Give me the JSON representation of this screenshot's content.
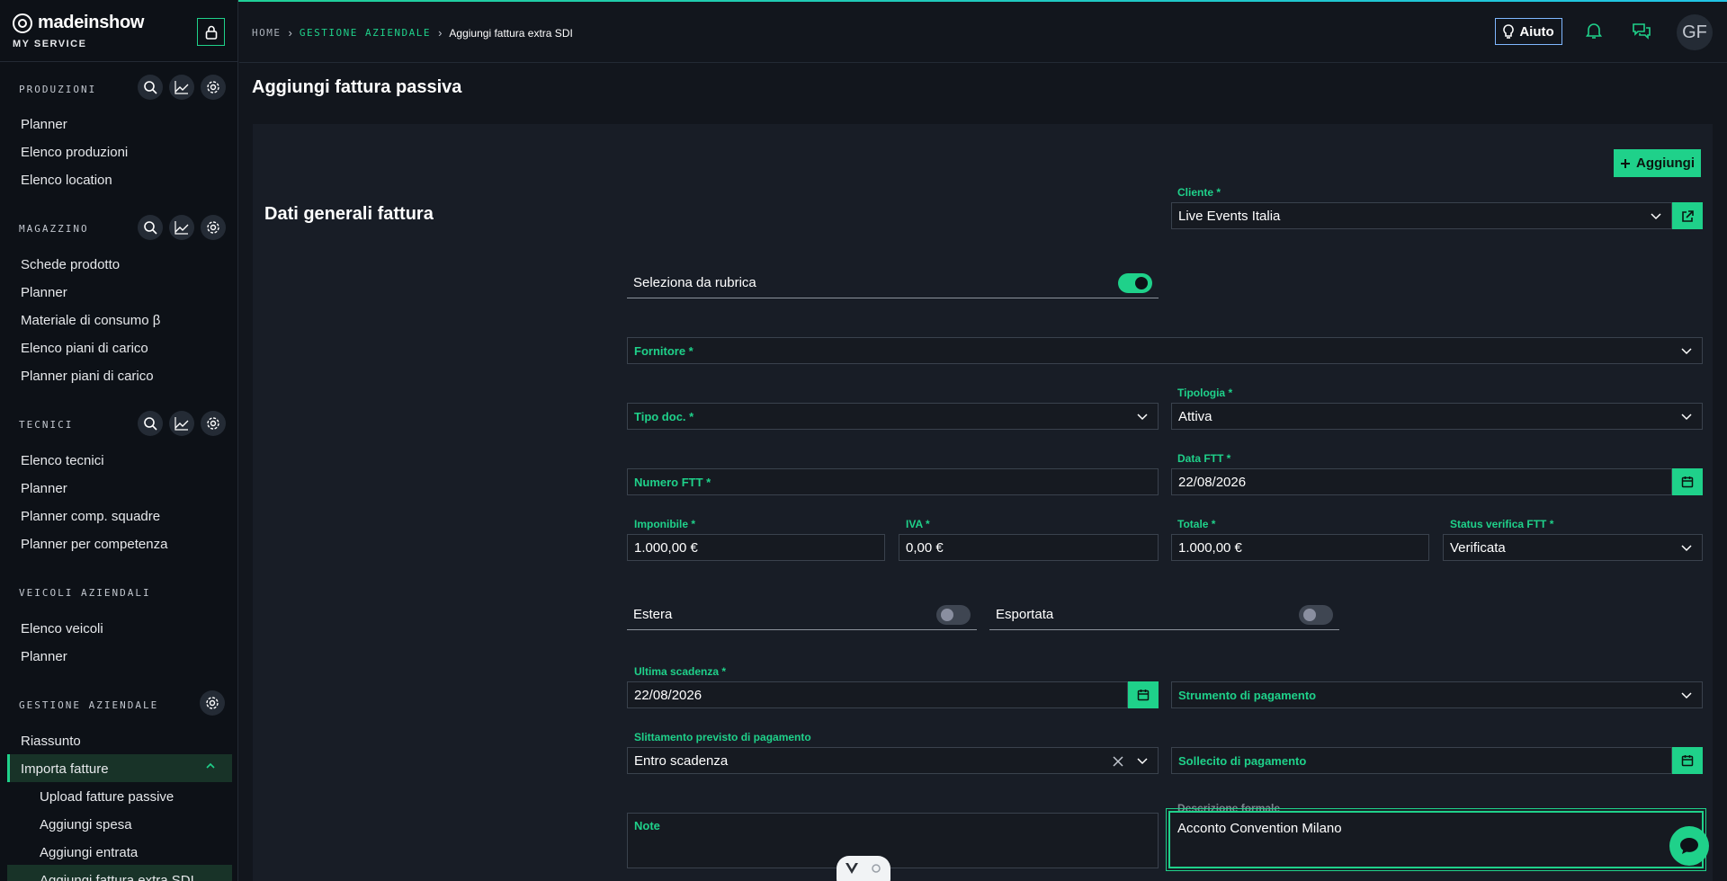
{
  "brand": {
    "name": "madeinshow",
    "subtitle": "MY SERVICE"
  },
  "sidebar": {
    "sections": [
      {
        "title": "PRODUZIONI",
        "items": [
          "Planner",
          "Elenco produzioni",
          "Elenco location"
        ]
      },
      {
        "title": "MAGAZZINO",
        "items": [
          "Schede prodotto",
          "Planner",
          "Materiale di consumo β",
          "Elenco piani di carico",
          "Planner piani di carico"
        ]
      },
      {
        "title": "TECNICI",
        "items": [
          "Elenco tecnici",
          "Planner",
          "Planner comp. squadre",
          "Planner per competenza"
        ]
      },
      {
        "title": "VEICOLI AZIENDALI",
        "items": [
          "Elenco veicoli",
          "Planner"
        ]
      },
      {
        "title": "GESTIONE AZIENDALE",
        "items": [
          "Riassunto",
          "Importa fatture"
        ]
      }
    ],
    "sub_items": [
      "Upload fatture passive",
      "Aggiungi spesa",
      "Aggiungi entrata",
      "Aggiungi fattura extra SDI"
    ]
  },
  "header": {
    "breadcrumb_home": "HOME",
    "breadcrumb_section": "GESTIONE AZIENDALE",
    "breadcrumb_current": "Aggiungi fattura extra SDI",
    "help_label": "Aiuto",
    "avatar_initials": "GF"
  },
  "page": {
    "title": "Aggiungi fattura passiva",
    "add_button": "Aggiungi",
    "section_title": "Dati generali fattura"
  },
  "form": {
    "cliente_label": "Cliente *",
    "cliente_value": "Live Events Italia",
    "rubrica_label": "Seleziona da rubrica",
    "rubrica_on": true,
    "fornitore_label": "Fornitore *",
    "tipo_doc_label": "Tipo doc. *",
    "tipologia_label": "Tipologia *",
    "tipologia_value": "Attiva",
    "numero_label": "Numero FTT *",
    "data_label": "Data FTT *",
    "data_value": "22/08/2026",
    "imponibile_label": "Imponibile *",
    "imponibile_value": "1.000,00 €",
    "iva_label": "IVA *",
    "iva_value": "0,00 €",
    "totale_label": "Totale *",
    "totale_value": "1.000,00 €",
    "status_label": "Status verifica FTT *",
    "status_value": "Verificata",
    "estera_label": "Estera",
    "esportata_label": "Esportata",
    "ultima_label": "Ultima scadenza *",
    "ultima_value": "22/08/2026",
    "strumento_label": "Strumento di pagamento",
    "slittamento_label": "Slittamento previsto di pagamento",
    "slittamento_value": "Entro scadenza",
    "sollecito_label": "Sollecito di pagamento",
    "note_label": "Note",
    "descrizione_label": "Descrizione formale",
    "descrizione_value": "Acconto Convention Milano"
  },
  "colors": {
    "accent": "#1fd18a",
    "background": "#12161d",
    "card": "#181d26"
  }
}
